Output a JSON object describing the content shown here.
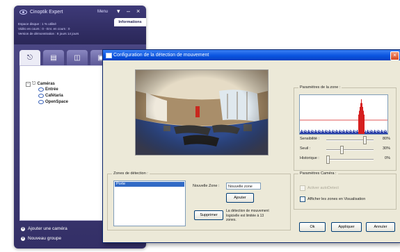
{
  "app": {
    "title": "Cinoptik Expert",
    "menu_label": "Menu",
    "window_controls": [
      "▾",
      "–",
      "×"
    ],
    "info_tab": "Informations",
    "info_lines": [
      "Espace disque : 1 % utilisé",
      "Vidéo en cours : 0 - Enr. en cours : 0",
      "Version de démonstration : 8 jours 14 jours"
    ],
    "tabs": [
      {
        "icon": "camera-icon"
      },
      {
        "icon": "monitor-icon"
      },
      {
        "icon": "layout-icon"
      },
      {
        "icon": "view-icon"
      }
    ],
    "tree": {
      "root": "Caméras",
      "items": [
        "Entrée",
        "Cafétaria",
        "OpenSpace"
      ]
    },
    "bottom_actions": {
      "add_camera": "Ajouter une caméra",
      "new_group": "Nouveau groupe"
    },
    "colors": {
      "header": "#2a2758",
      "accent": "#4b4784"
    }
  },
  "dialog": {
    "title": "Configuration de la détection de mouvement",
    "close_symbol": "×",
    "zone_params": {
      "label": "Paramètres de la zone :",
      "histogram_colors": {
        "bars": "#2b3fa8",
        "peak": "#d61f1f",
        "line": "#d61f1f"
      },
      "sliders": [
        {
          "label": "Sensibilité :",
          "value": "80%",
          "level": 0.8
        },
        {
          "label": "Seuil :",
          "value": "30%",
          "level": 0.3
        },
        {
          "label": "Historique :",
          "value": "0%",
          "level": 0.0
        }
      ]
    },
    "zones": {
      "label": "Zones de détection :",
      "list": [
        "Porte"
      ],
      "new_zone_label": "Nouvelle Zone :",
      "new_zone_value": "Nouvelle zone",
      "add_button": "Ajouter",
      "delete_button": "Supprimer",
      "note": "La détection de mouvement logicielle est limitée à 13 zones."
    },
    "camera_params": {
      "label": "Paramètres Caméra :",
      "enable_detection": "Activer autoDetect",
      "show_zones": "Afficher les zones en Visualisation"
    },
    "buttons": {
      "ok": "Ok",
      "apply": "Appliquer",
      "cancel": "Annuler"
    }
  }
}
